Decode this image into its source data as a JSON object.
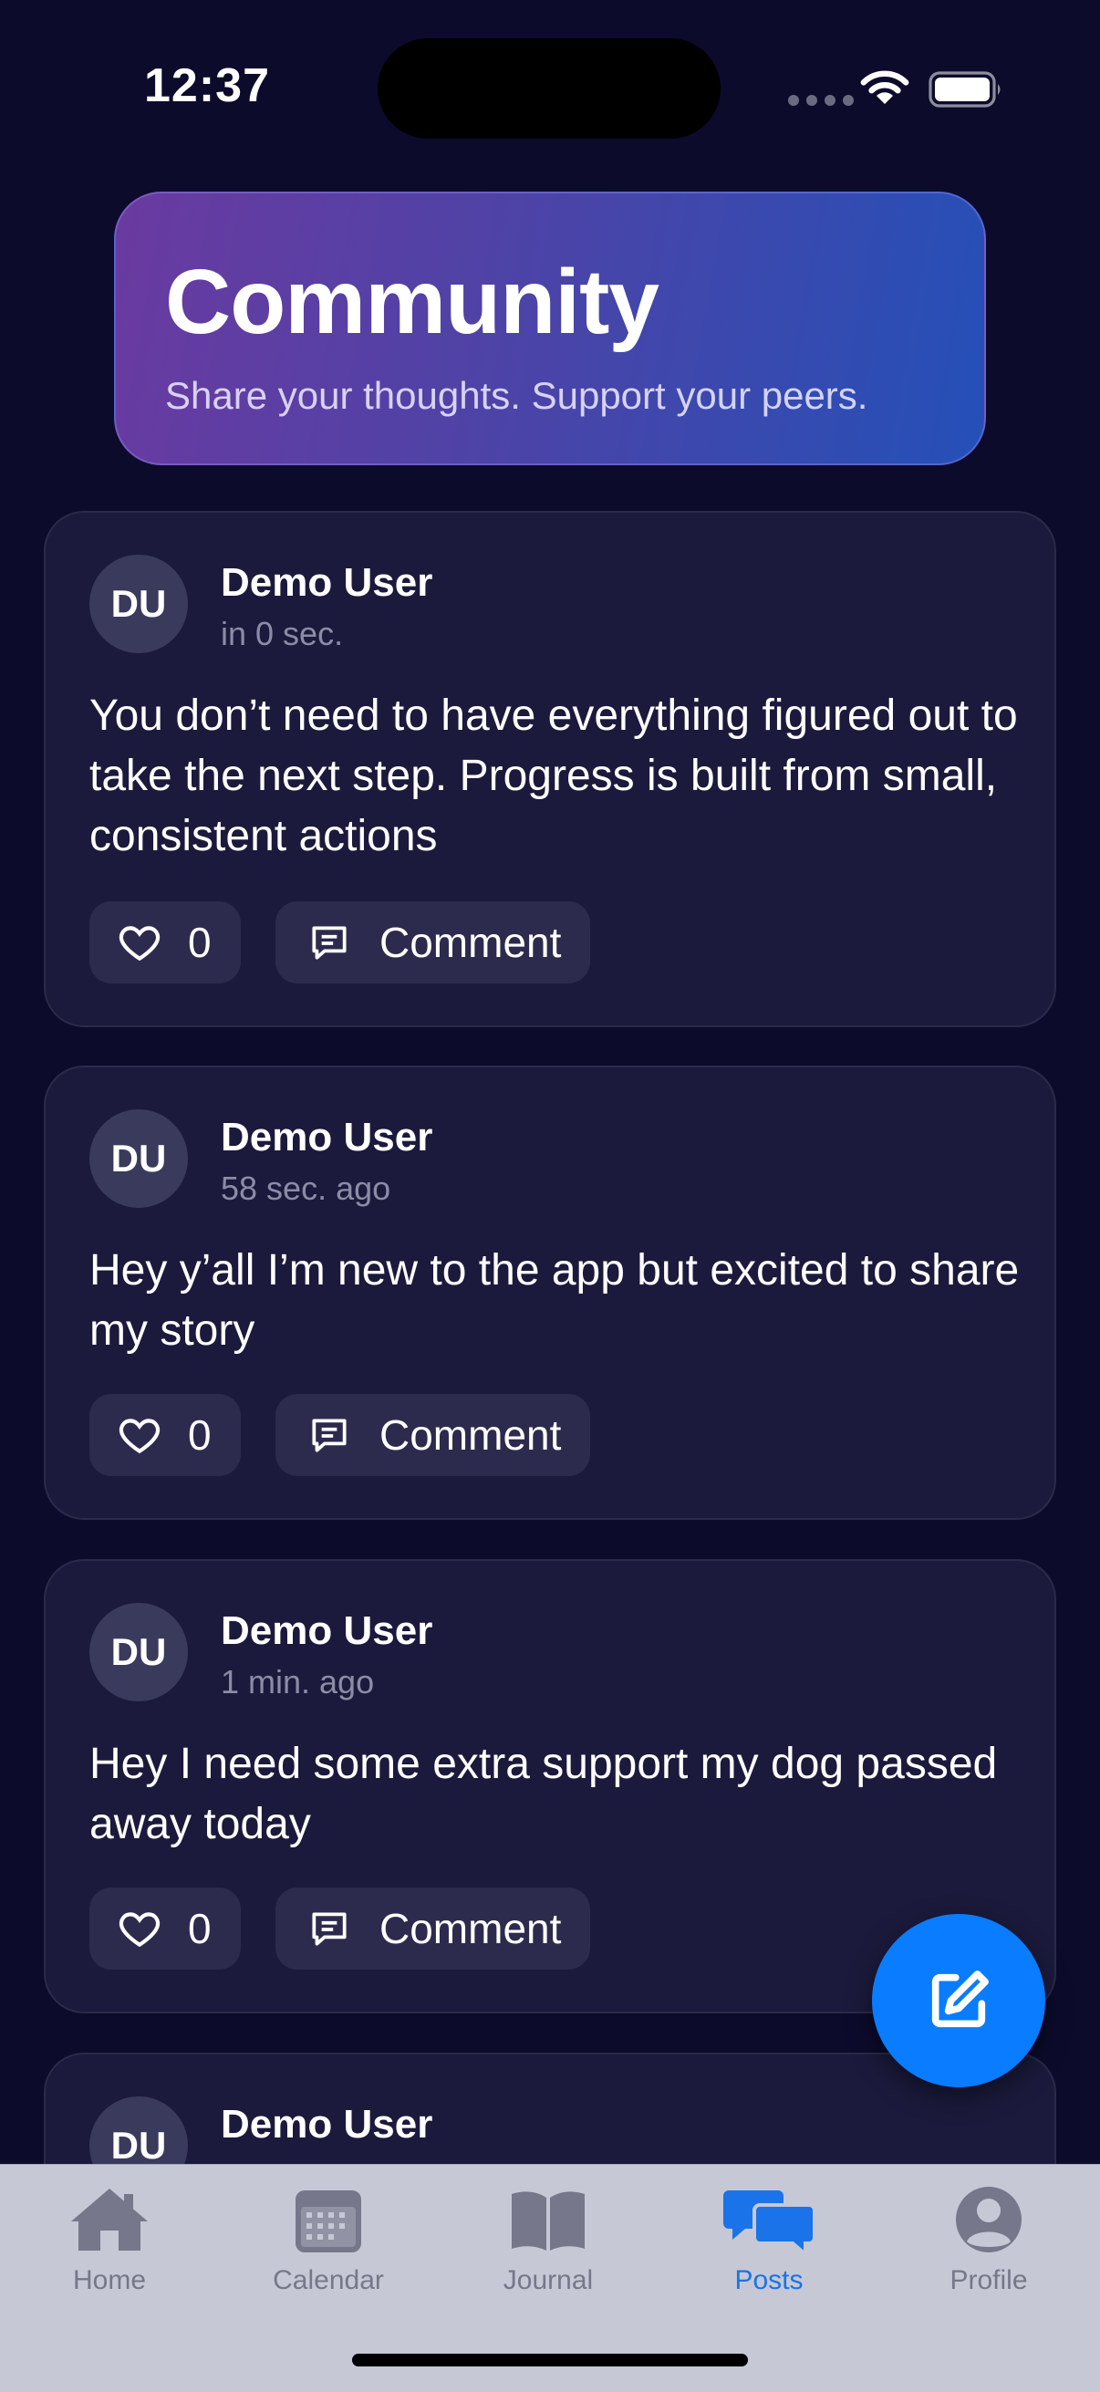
{
  "status_bar": {
    "time": "12:37"
  },
  "header": {
    "title": "Community",
    "subtitle": "Share your thoughts. Support your peers."
  },
  "posts": [
    {
      "avatar_initials": "DU",
      "author": "Demo User",
      "time": "in 0 sec.",
      "text": "You don’t need to have everything figured out to take the next step. Progress is built from small, consistent actions",
      "likes": "0",
      "comment_label": "Comment"
    },
    {
      "avatar_initials": "DU",
      "author": "Demo User",
      "time": "58 sec. ago",
      "text": "Hey y’all I’m new to the app but excited to share my story",
      "likes": "0",
      "comment_label": "Comment"
    },
    {
      "avatar_initials": "DU",
      "author": "Demo User",
      "time": "1 min. ago",
      "text": "Hey I need some extra support my dog passed away today",
      "likes": "0",
      "comment_label": "Comment"
    },
    {
      "avatar_initials": "DU",
      "author": "Demo User"
    }
  ],
  "fab": {
    "icon": "compose-icon"
  },
  "tab_bar": {
    "items": [
      {
        "label": "Home",
        "icon": "house-icon",
        "active": false
      },
      {
        "label": "Calendar",
        "icon": "calendar-icon",
        "active": false
      },
      {
        "label": "Journal",
        "icon": "book-icon",
        "active": false
      },
      {
        "label": "Posts",
        "icon": "chat-bubbles-icon",
        "active": true
      },
      {
        "label": "Profile",
        "icon": "person-icon",
        "active": false
      }
    ]
  },
  "colors": {
    "background": "#0c0b2c",
    "card": "#1b1a3c",
    "accent": "#0a7cff",
    "tab_active": "#1a73e8",
    "tab_inactive": "#76778a"
  }
}
